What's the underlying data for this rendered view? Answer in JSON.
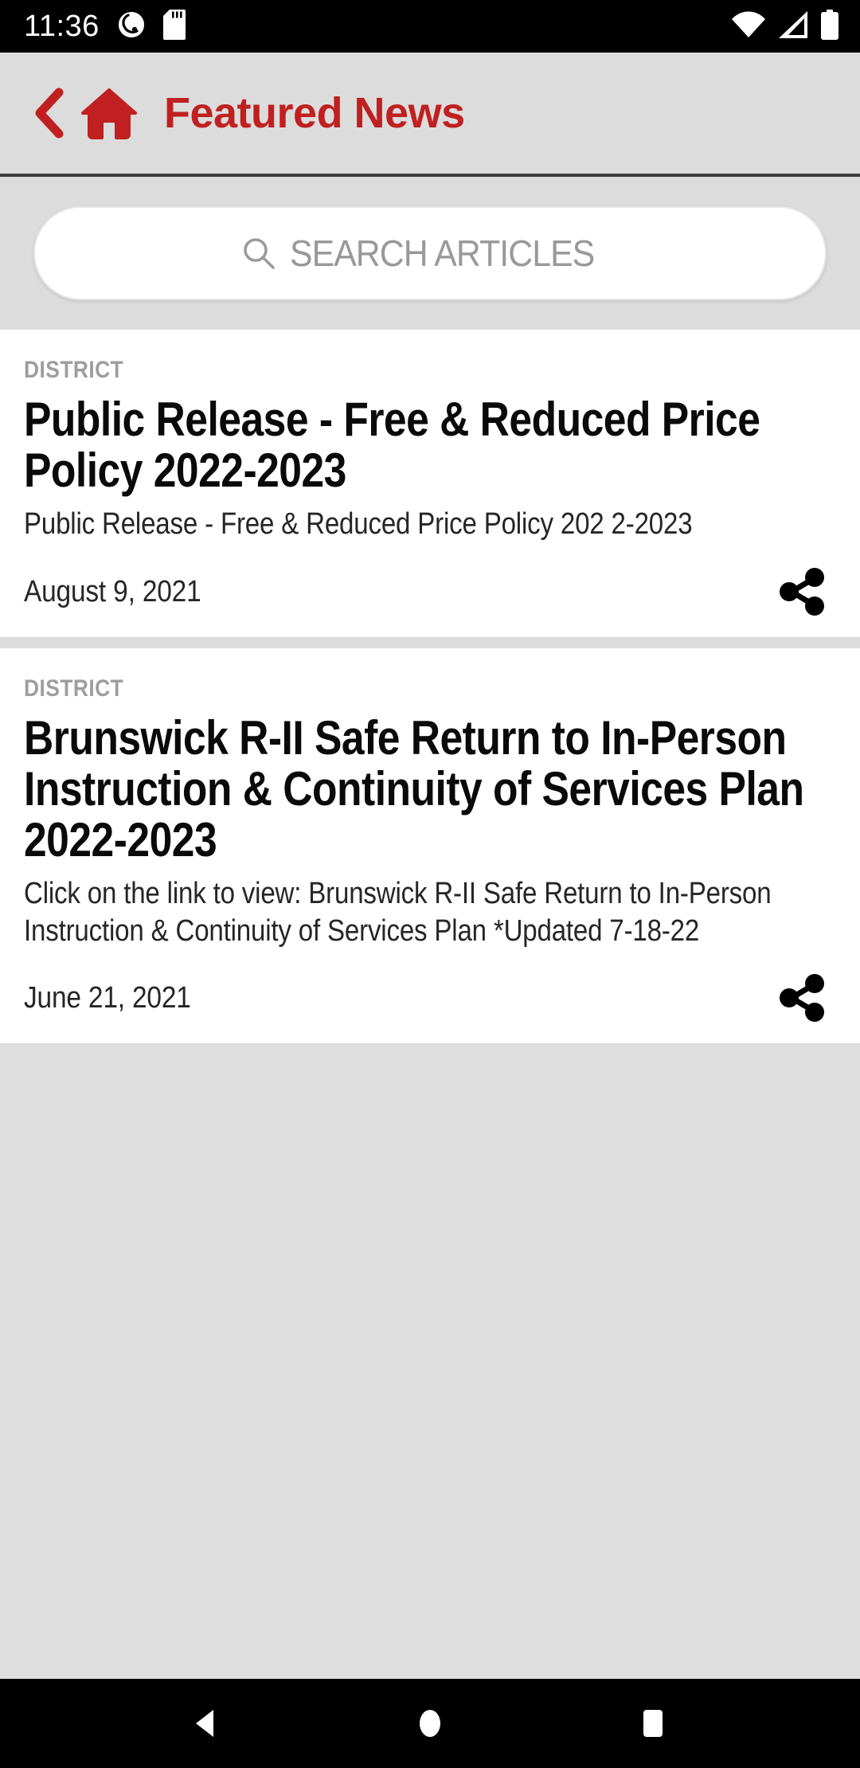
{
  "status_bar": {
    "clock": "11:36",
    "left_icons": [
      "sync-icon",
      "sd-card-icon"
    ],
    "right_icons": [
      "wifi-icon",
      "cellular-signal-icon",
      "battery-icon"
    ]
  },
  "header": {
    "back_label": "Back",
    "home_label": "Home",
    "title": "Featured News",
    "accent_color": "#c0201f",
    "background_color": "#dcdcdc"
  },
  "search": {
    "placeholder": "SEARCH ARTICLES",
    "value": ""
  },
  "articles": [
    {
      "category": "DISTRICT",
      "headline": "Public Release - Free & Reduced Price Policy 2022-2023",
      "summary": "Public Release - Free & Reduced Price Policy 202 2-2023",
      "date": "August 9, 2021",
      "share_label": "Share"
    },
    {
      "category": "DISTRICT",
      "headline": "Brunswick R-II Safe Return to In-Person Instruction & Continuity of Services Plan 2022-2023",
      "summary": "Click on the link to view: Brunswick R-II Safe Return to In-Person Instruction & Continuity of Services Plan *Updated 7-18-22",
      "date": "June 21, 2021",
      "share_label": "Share"
    }
  ],
  "nav_bar": {
    "back_label": "Back",
    "home_label": "Home",
    "recents_label": "Recents"
  }
}
